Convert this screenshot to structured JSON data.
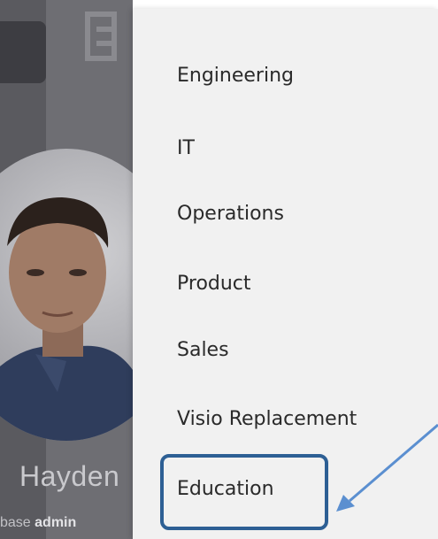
{
  "menu": {
    "items": [
      {
        "label": "Engineering"
      },
      {
        "label": "IT"
      },
      {
        "label": "Operations"
      },
      {
        "label": "Product"
      },
      {
        "label": "Sales"
      },
      {
        "label": "Visio Replacement"
      },
      {
        "label": "Education"
      }
    ],
    "highlighted_item": "Education"
  },
  "profile": {
    "name": "Hayden",
    "role_prefix": "base",
    "role_bold": "admin"
  },
  "colors": {
    "highlight_border": "#2d5f94",
    "arrow": "#5b8fd0",
    "menu_background": "#f1f1f1",
    "dimmed_background": "#6e6e73"
  }
}
